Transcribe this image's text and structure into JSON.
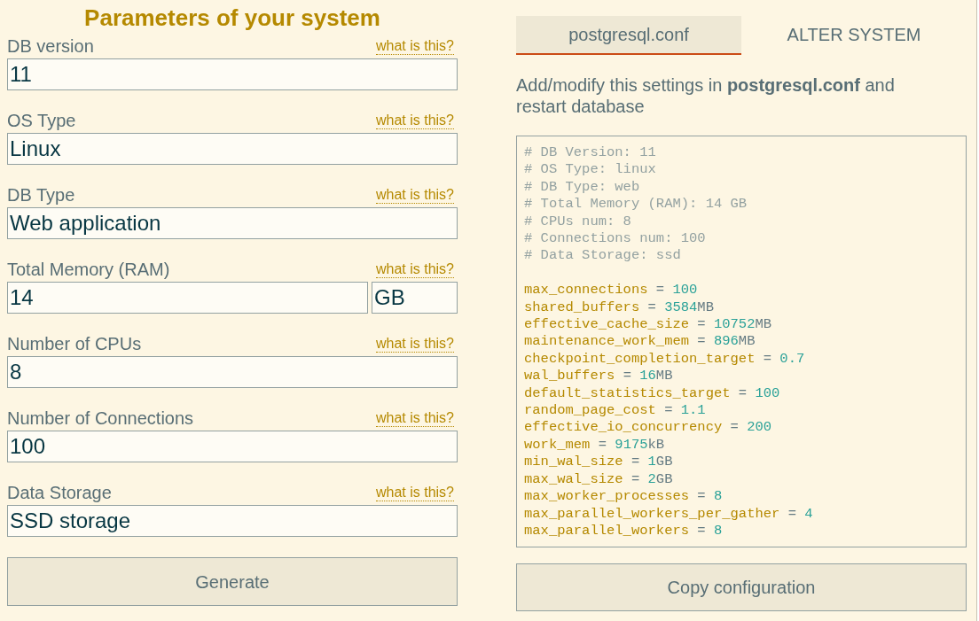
{
  "form": {
    "title": "Parameters of your system",
    "fields": [
      {
        "label": "DB version",
        "help": "what is this?",
        "value": "11"
      },
      {
        "label": "OS Type",
        "help": "what is this?",
        "value": "Linux"
      },
      {
        "label": "DB Type",
        "help": "what is this?",
        "value": "Web application"
      },
      {
        "label": "Total Memory (RAM)",
        "help": "what is this?",
        "value": "14",
        "unit": "GB"
      },
      {
        "label": "Number of CPUs",
        "help": "what is this?",
        "value": "8"
      },
      {
        "label": "Number of Connections",
        "help": "what is this?",
        "value": "100"
      },
      {
        "label": "Data Storage",
        "help": "what is this?",
        "value": "SSD storage"
      }
    ],
    "generate_button": "Generate"
  },
  "output": {
    "tabs": [
      {
        "label": "postgresql.conf",
        "selected": true
      },
      {
        "label": "ALTER SYSTEM",
        "selected": false
      }
    ],
    "instructions": "Add/modify this settings in **postgresql.conf** and restart database",
    "config": {
      "comments": [
        "# DB Version: 11",
        "# OS Type: linux",
        "# DB Type: web",
        "# Total Memory (RAM): 14 GB",
        "# CPUs num: 8",
        "# Connections num: 100",
        "# Data Storage: ssd"
      ],
      "settings": [
        {
          "key": "max_connections",
          "operator": "=",
          "value": "100"
        },
        {
          "key": "shared_buffers",
          "operator": "=",
          "value": "3584",
          "unit": "MB"
        },
        {
          "key": "effective_cache_size",
          "operator": "=",
          "value": "10752",
          "unit": "MB"
        },
        {
          "key": "maintenance_work_mem",
          "operator": "=",
          "value": "896",
          "unit": "MB"
        },
        {
          "key": "checkpoint_completion_target",
          "operator": "=",
          "value": "0.7"
        },
        {
          "key": "wal_buffers",
          "operator": "=",
          "value": "16",
          "unit": "MB"
        },
        {
          "key": "default_statistics_target",
          "operator": "=",
          "value": "100"
        },
        {
          "key": "random_page_cost",
          "operator": "=",
          "value": "1.1"
        },
        {
          "key": "effective_io_concurrency",
          "operator": "=",
          "value": "200"
        },
        {
          "key": "work_mem",
          "operator": "=",
          "value": "9175",
          "unit": "kB"
        },
        {
          "key": "min_wal_size",
          "operator": "=",
          "value": "1",
          "unit": "GB"
        },
        {
          "key": "max_wal_size",
          "operator": "=",
          "value": "2",
          "unit": "GB"
        },
        {
          "key": "max_worker_processes",
          "operator": "=",
          "value": "8"
        },
        {
          "key": "max_parallel_workers_per_gather",
          "operator": "=",
          "value": "4"
        },
        {
          "key": "max_parallel_workers",
          "operator": "=",
          "value": "8"
        }
      ]
    },
    "copy_button": "Copy configuration"
  }
}
